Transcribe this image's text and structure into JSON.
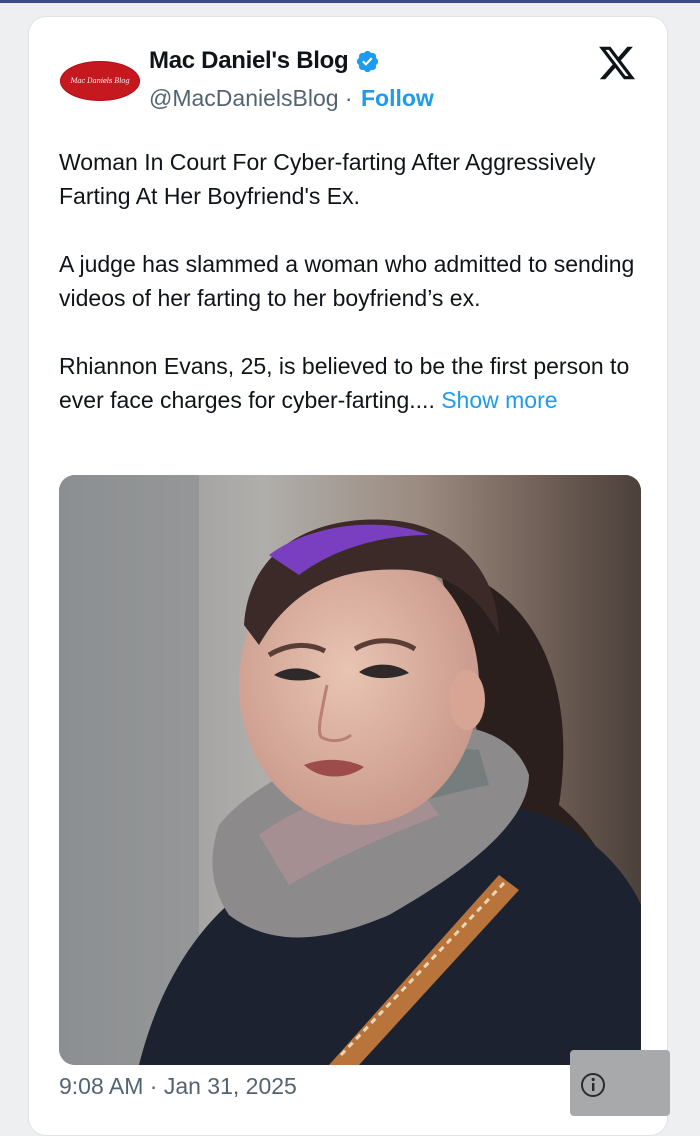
{
  "author": {
    "avatar_text": "Mac Daniels Blog",
    "name": "Mac Daniel's Blog",
    "handle": "@MacDanielsBlog",
    "separator": " · ",
    "follow_label": "Follow"
  },
  "post": {
    "paragraphs": [
      "Woman In Court For Cyber-farting After Aggressively Farting At Her Boyfriend's Ex.",
      "A judge has slammed a woman who admitted to sending videos of her farting to her boyfriend’s ex."
    ],
    "last_paragraph": "Rhiannon Evans, 25, is believed to be the first person to ever face charges for cyber-farting.... ",
    "show_more_label": "Show more"
  },
  "timestamp": "9:08 AM · Jan 31, 2025",
  "colors": {
    "link_blue": "#1d9bf0",
    "verified_blue": "#1d9bf0",
    "avatar_red": "#c5191f",
    "text_primary": "#0f1419",
    "text_secondary": "#536471"
  },
  "icons": {
    "verified": "verified-badge-icon",
    "platform": "x-logo-icon",
    "info": "info-icon"
  }
}
